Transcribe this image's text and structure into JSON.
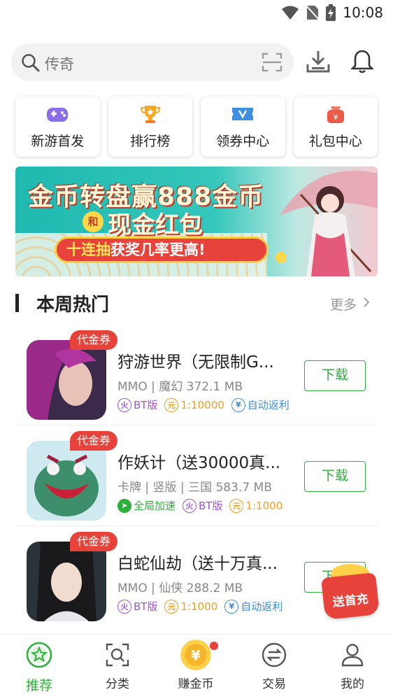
{
  "status_bar": {
    "time": "10:08"
  },
  "search": {
    "placeholder": "传奇"
  },
  "quick_entries": [
    {
      "label": "新游首发",
      "icon": "gamepad-icon"
    },
    {
      "label": "排行榜",
      "icon": "trophy-icon"
    },
    {
      "label": "领券中心",
      "icon": "coupon-icon"
    },
    {
      "label": "礼包中心",
      "icon": "gift-bag-icon"
    }
  ],
  "banner": {
    "line1": "金币转盘赢888金币",
    "and": "和",
    "line2": "现金红包",
    "pill_prefix": "十连抽",
    "pill_rest": "获奖几率更高!"
  },
  "section": {
    "title": "本周热门",
    "more": "更多"
  },
  "games": [
    {
      "badge": "代金券",
      "name": "狩游世界（无限制G...",
      "meta": "MMO | 魔幻 372.1 MB",
      "tags": [
        {
          "glyph": "火",
          "text": "BT版",
          "style": "purple"
        },
        {
          "glyph": "元",
          "text": "1:10000",
          "style": "orange"
        },
        {
          "glyph": "¥",
          "text": "自动返利",
          "style": "blue"
        }
      ],
      "button": "下载"
    },
    {
      "badge": "代金券",
      "name": "作妖计（送30000真...",
      "meta": "卡牌 | 竖版 | 三国 583.7 MB",
      "tags": [
        {
          "glyph": "➤",
          "text": "全局加速",
          "style": "green"
        },
        {
          "glyph": "火",
          "text": "BT版",
          "style": "purple"
        },
        {
          "glyph": "元",
          "text": "1:1000",
          "style": "orange"
        }
      ],
      "button": "下载"
    },
    {
      "badge": "代金券",
      "name": "白蛇仙劫（送十万真...",
      "meta": "MMO | 仙侠 288.2 MB",
      "tags": [
        {
          "glyph": "火",
          "text": "BT版",
          "style": "purple"
        },
        {
          "glyph": "元",
          "text": "1:1000",
          "style": "orange"
        },
        {
          "glyph": "¥",
          "text": "自动返利",
          "style": "blue"
        }
      ],
      "button": "下载"
    }
  ],
  "floating": {
    "label": "送首充"
  },
  "nav": [
    {
      "label": "推荐",
      "active": true
    },
    {
      "label": "分类",
      "active": false
    },
    {
      "label": "赚金币",
      "active": false
    },
    {
      "label": "交易",
      "active": false
    },
    {
      "label": "我的",
      "active": false
    }
  ],
  "colors": {
    "accent": "#2eb03b",
    "red": "#e8433b"
  }
}
